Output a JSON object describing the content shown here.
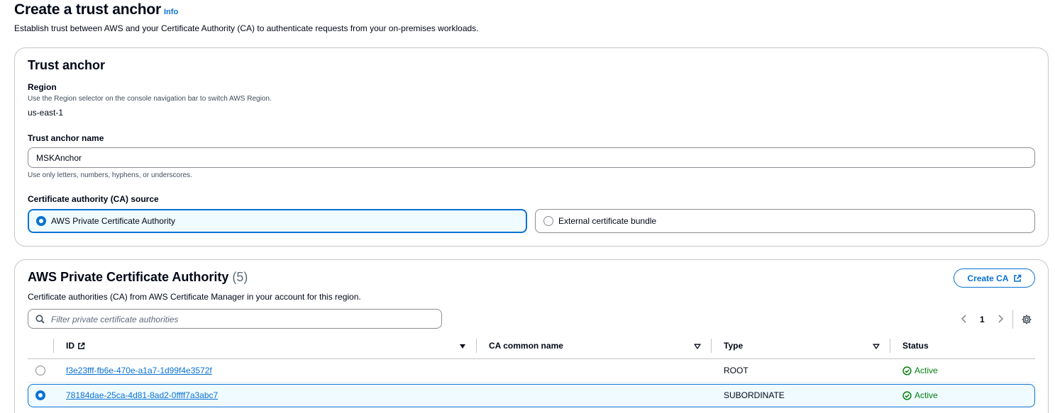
{
  "header": {
    "title": "Create a trust anchor",
    "info_label": "Info",
    "description": "Establish trust between AWS and your Certificate Authority (CA) to authenticate requests from your on-premises workloads."
  },
  "trust_anchor": {
    "heading": "Trust anchor",
    "region_label": "Region",
    "region_hint": "Use the Region selector on the console navigation bar to switch AWS Region.",
    "region_value": "us-east-1",
    "name_label": "Trust anchor name",
    "name_value": "MSKAnchor",
    "name_hint": "Use only letters, numbers, hyphens, or underscores.",
    "source_label": "Certificate authority (CA) source",
    "source_options": [
      {
        "label": "AWS Private Certificate Authority",
        "selected": true
      },
      {
        "label": "External certificate bundle",
        "selected": false
      }
    ]
  },
  "pca": {
    "heading": "AWS Private Certificate Authority",
    "count": "(5)",
    "description": "Certificate authorities (CA) from AWS Certificate Manager in your account for this region.",
    "create_button": "Create CA",
    "filter_placeholder": "Filter private certificate authorities",
    "page": "1",
    "columns": [
      "ID",
      "CA common name",
      "Type",
      "Status"
    ],
    "rows": [
      {
        "id": "f3e23fff-fb6e-470e-a1a7-1d99f4e3572f",
        "common_name": "",
        "type": "ROOT",
        "status": "Active",
        "selected": false
      },
      {
        "id": "78184dae-25ca-4d81-8ad2-0ffff7a3abc7",
        "common_name": "",
        "type": "SUBORDINATE",
        "status": "Active",
        "selected": true
      }
    ]
  },
  "colors": {
    "accent": "#0972d3",
    "success": "#037f0c",
    "border": "#c6c6cd",
    "selected_bg": "#f0fbff"
  },
  "icons": [
    "external-link-icon",
    "search-icon",
    "chevron-left-icon",
    "chevron-right-icon",
    "settings-gear-icon",
    "sort-caret-icon",
    "status-check-icon"
  ]
}
